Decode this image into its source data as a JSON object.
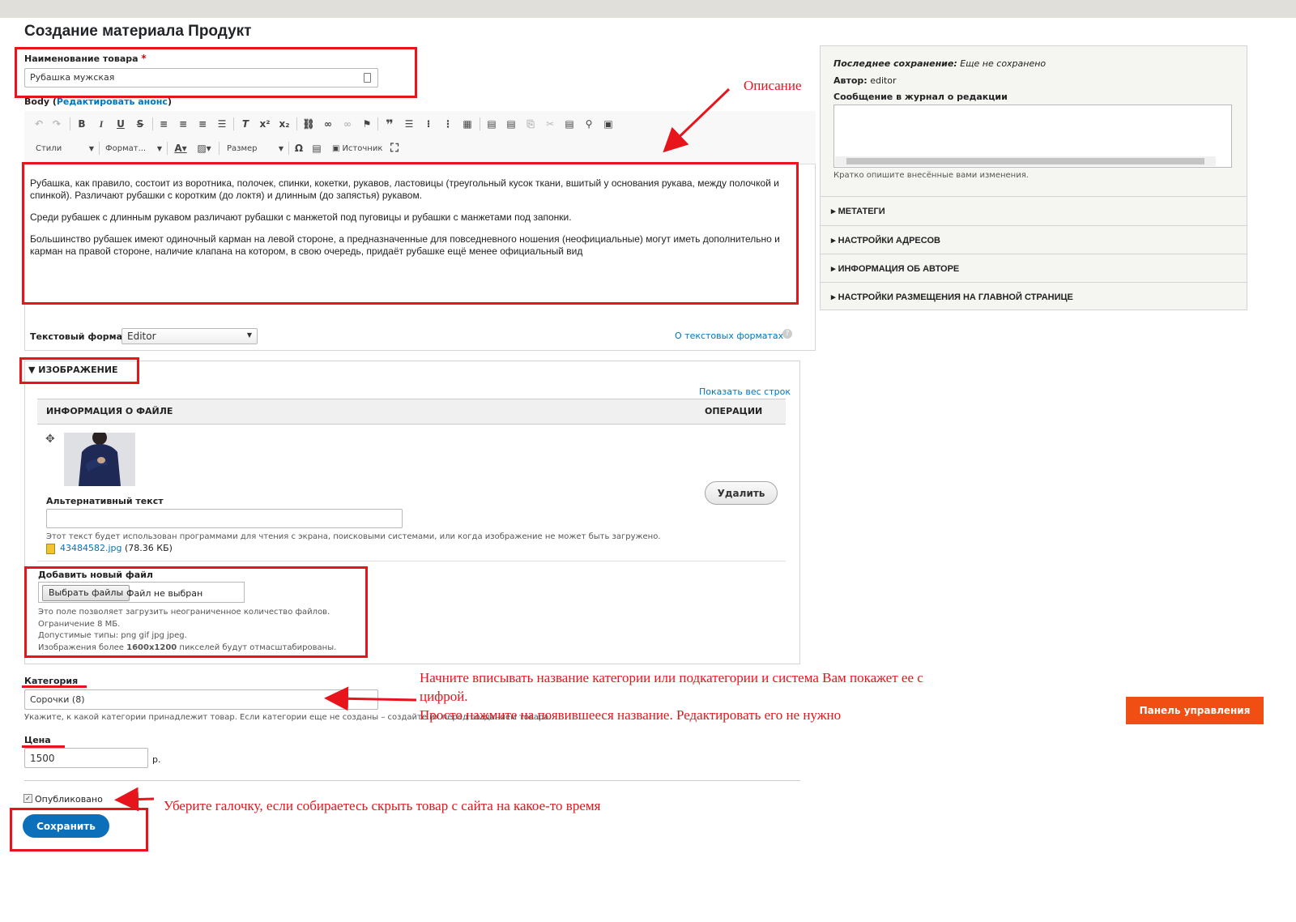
{
  "page": {
    "title": "Создание материала Продукт"
  },
  "product_name": {
    "label": "Наименование товара",
    "required_mark": "*",
    "value": "Рубашка мужская"
  },
  "body_field": {
    "label": "Body",
    "summary_link_open": "(",
    "summary_link": "Редактировать анонс",
    "summary_link_close": ")",
    "toolbar": {
      "bold": "B",
      "italic": "I",
      "underline": "U",
      "strike": "S",
      "styles": "Стили",
      "format": "Формат...",
      "size": "Размер",
      "source": "Источник",
      "omega": "Ω"
    },
    "paragraphs": [
      "Рубашка, как правило, состоит из воротника, полочек, спинки, кокетки, рукавов, ластовицы (треугольный кусок ткани, вшитый у основания рукава, между полочкой и спинкой). Различают рубашки с коротким (до локтя) и длинным (до запястья) рукавом.",
      "Среди рубашек с длинным рукавом различают рубашки с манжетой под пуговицы и рубашки с манжетами под запонки.",
      "Большинство рубашек имеют одиночный карман на левой стороне, а предназначенные для повседневного ношения (неофициальные) могут иметь дополнительно и карман на правой стороне, наличие клапана на котором, в свою очередь, придаёт рубашке ещё менее официальный вид"
    ],
    "text_format_label": "Текстовый формат",
    "text_format_value": "Editor",
    "text_format_help": "О текстовых форматах"
  },
  "image_section": {
    "title": "ИЗОБРАЖЕНИЕ",
    "show_weights": "Показать вес строк",
    "col_file_info": "ИНФОРМАЦИЯ О ФАЙЛЕ",
    "col_operations": "ОПЕРАЦИИ",
    "alt_label": "Альтернативный текст",
    "alt_value": "",
    "alt_help": "Этот текст будет использован программами для чтения с экрана, поисковыми системами, или когда изображение не может быть загружено.",
    "file_name": "43484582.jpg",
    "file_size": "(78.36 КБ)",
    "remove_button": "Удалить",
    "add_new_label": "Добавить новый файл",
    "choose_button": "Выбрать файлы",
    "no_file": "Файл не выбран",
    "help_lines": [
      "Это поле позволяет загрузить неограниченное количество файлов.",
      "Ограничение 8 МБ.",
      "Допустимые типы: png gif jpg jpeg."
    ],
    "help_last_prefix": "Изображения более ",
    "help_last_bold": "1600x1200",
    "help_last_suffix": " пикселей будут отмасштабированы."
  },
  "category": {
    "label": "Категория",
    "value": "Сорочки (8)",
    "help": "Укажите, к какой категории принадлежит товар. Если категории еще не созданы – создайте их перед созданием товара."
  },
  "price": {
    "label": "Цена",
    "value": "1500",
    "suffix": "р."
  },
  "published": {
    "label": "Опубликовано",
    "checked": true
  },
  "save_button": "Сохранить",
  "sidebar": {
    "last_saved_label": "Последнее сохранение:",
    "last_saved_value": "Еще не сохранено",
    "author_label": "Автор:",
    "author_value": "editor",
    "log_label": "Сообщение в журнал о редакции",
    "log_value": "",
    "log_help": "Кратко опишите внесённые вами изменения.",
    "sections": [
      "МЕТАТЕГИ",
      "НАСТРОЙКИ АДРЕСОВ",
      "ИНФОРМАЦИЯ ОБ АВТОРЕ",
      "НАСТРОЙКИ РАЗМЕЩЕНИЯ НА ГЛАВНОЙ СТРАНИЦЕ"
    ]
  },
  "control_panel_button": "Панель управления",
  "annotations": {
    "description": "Описание",
    "category_line1": "Начните вписывать название категории или подкатегории и система Вам покажет ее с",
    "category_line2": "цифрой.",
    "category_line3": "Просто нажмите на появившееся название. Редактировать его не нужно",
    "published": "Уберите галочку, если собираетесь скрыть товар с сайта на какое-то время"
  },
  "colors": {
    "annotation_red": "#e8141b",
    "link_blue": "#0074bd",
    "save_blue": "#0b6fba",
    "panel_orange": "#f04e12"
  },
  "icons": [
    "expand-icon",
    "drag-handle-icon",
    "file-image-icon",
    "help-icon",
    "dropdown-caret-icon"
  ]
}
